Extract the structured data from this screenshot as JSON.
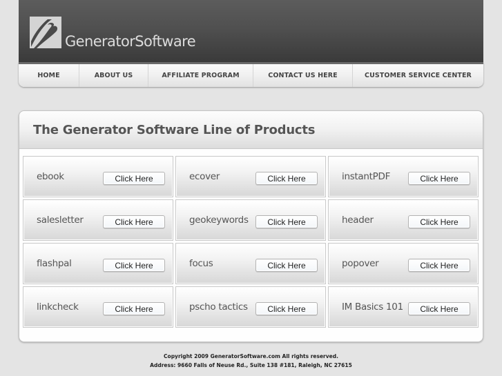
{
  "brand": {
    "name": "GeneratorSoftware",
    "logo_icon": "stylized-G-swoosh-icon"
  },
  "nav": {
    "items": [
      {
        "label": "HOME"
      },
      {
        "label": "ABOUT US"
      },
      {
        "label": "AFFILIATE PROGRAM"
      },
      {
        "label": "CONTACT US HERE"
      },
      {
        "label": "CUSTOMER SERVICE CENTER"
      }
    ]
  },
  "products": {
    "title": "The Generator Software Line of Products",
    "button_label": "Click Here",
    "items": [
      {
        "name": "ebook",
        "button": "Click Here"
      },
      {
        "name": "ecover",
        "button": "Click Here"
      },
      {
        "name": "instantPDF",
        "button": "Click Here"
      },
      {
        "name": "salesletter",
        "button": "Click Here"
      },
      {
        "name": "geokeywords",
        "button": "Click Here"
      },
      {
        "name": "header",
        "button": "Click Here"
      },
      {
        "name": "flashpal",
        "button": "Click Here"
      },
      {
        "name": "focus",
        "button": "Click Here"
      },
      {
        "name": "popover",
        "button": "Click Here"
      },
      {
        "name": "linkcheck",
        "button": "Click Here"
      },
      {
        "name": "pscho tactics",
        "button": "Click Here"
      },
      {
        "name": "IM Basics 101",
        "button": "Click Here"
      }
    ]
  },
  "footer": {
    "copyright": "Copyright 2009 GeneratorSoftware.com All rights reserved.",
    "address": "Address: 9660 Falls of Neuse Rd., Suite 138 #181, Raleigh, NC 27615"
  }
}
